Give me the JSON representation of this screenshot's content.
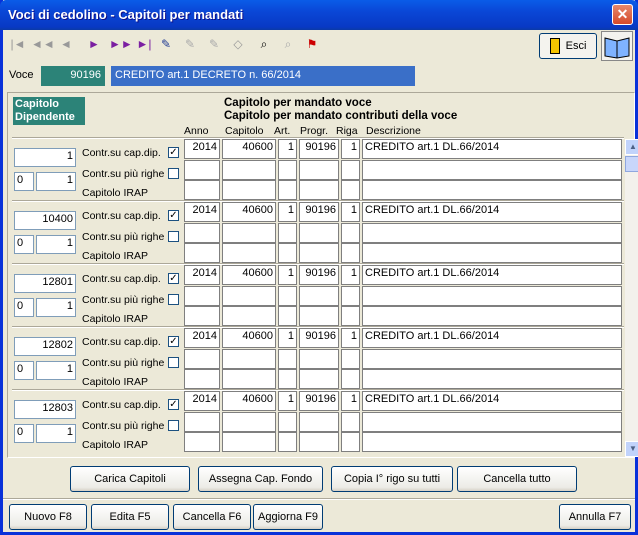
{
  "window": {
    "title": "Voci di cedolino - Capitoli per mandati",
    "close_label": "✕"
  },
  "toolbar": {
    "icons": [
      "first-record-icon",
      "prev-page-icon",
      "prev-record-icon",
      "next-record-icon",
      "next-page-icon",
      "last-record-icon",
      "edit-record-icon",
      "edit-disabled-icon",
      "eraser-icon",
      "search-icon",
      "search-disabled-icon",
      "filter-icon"
    ],
    "esci_label": "Esci"
  },
  "voce": {
    "label": "Voce",
    "code": "90196",
    "description": "CREDITO art.1 DECRETO n. 66/2014"
  },
  "header": {
    "capitolo_dipendente_line1": "Capitolo",
    "capitolo_dipendente_line2": "Dipendente",
    "line1": "Capitolo per mandato voce",
    "line2": "Capitolo per mandato contributi della voce",
    "columns": {
      "anno": "Anno",
      "capitolo": "Capitolo",
      "art": "Art.",
      "progr": "Progr.",
      "riga": "Riga",
      "descrizione": "Descrizione"
    }
  },
  "labels": {
    "contr_cap_dip": "Contr.su cap.dip.",
    "contr_piu_righe": "Contr.su più righe",
    "capitolo_irap": "Capitolo IRAP",
    "check_mark": "✓"
  },
  "rows": [
    {
      "capitolo": "1",
      "left": "0",
      "right": "1",
      "anno": "2014",
      "cap": "40600",
      "art": "1",
      "progr": "90196",
      "riga": "1",
      "descrizione": "CREDITO art.1 DL.66/2014"
    },
    {
      "capitolo": "10400",
      "left": "0",
      "right": "1",
      "anno": "2014",
      "cap": "40600",
      "art": "1",
      "progr": "90196",
      "riga": "1",
      "descrizione": "CREDITO art.1 DL.66/2014"
    },
    {
      "capitolo": "12801",
      "left": "0",
      "right": "1",
      "anno": "2014",
      "cap": "40600",
      "art": "1",
      "progr": "90196",
      "riga": "1",
      "descrizione": "CREDITO art.1 DL.66/2014"
    },
    {
      "capitolo": "12802",
      "left": "0",
      "right": "1",
      "anno": "2014",
      "cap": "40600",
      "art": "1",
      "progr": "90196",
      "riga": "1",
      "descrizione": "CREDITO art.1 DL.66/2014"
    },
    {
      "capitolo": "12803",
      "left": "0",
      "right": "1",
      "anno": "2014",
      "cap": "40600",
      "art": "1",
      "progr": "90196",
      "riga": "1",
      "descrizione": "CREDITO art.1 DL.66/2014"
    }
  ],
  "actions": {
    "carica": "Carica Capitoli",
    "assegna": "Assegna Cap. Fondo",
    "copia": "Copia I° rigo su tutti",
    "cancella_tutto": "Cancella tutto"
  },
  "footer": {
    "nuovo": "Nuovo F8",
    "edita": "Edita F5",
    "cancella": "Cancella F6",
    "aggiorna": "Aggiorna F9",
    "annulla": "Annulla F7"
  }
}
